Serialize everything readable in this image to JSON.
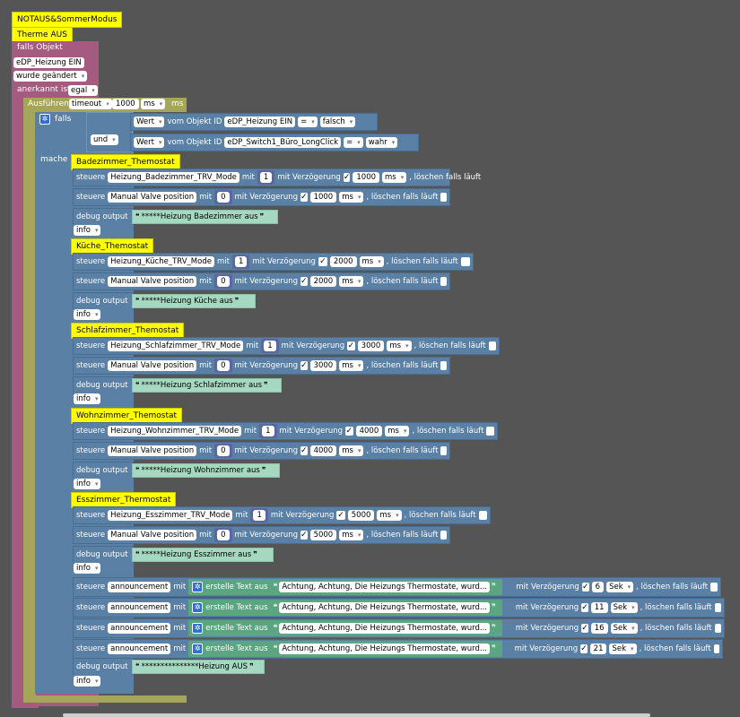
{
  "header": {
    "comment1": "NOTAUS&SommerModus",
    "comment2": "Therme AUS"
  },
  "trigger": {
    "falls_objekt": "falls Objekt",
    "object_id": "eDP_Heizung EIN",
    "wurde": "wurde geändert",
    "anerkannt": "anerkannt ist",
    "anerkannt_val": "egal"
  },
  "timeout": {
    "ausfuehren": "Ausführen",
    "timeout_dd": "timeout",
    "in": "in",
    "val": "1000",
    "unit": "ms",
    "unit2": "ms"
  },
  "if_block": {
    "falls": "falls",
    "und": "und",
    "mache": "mache",
    "cond1": {
      "wert": "Wert",
      "vom": "vom Objekt ID",
      "id": "eDP_Heizung EIN",
      "op": "=",
      "val": "falsch"
    },
    "cond2": {
      "wert": "Wert",
      "vom": "vom Objekt ID",
      "id": "eDP_Switch1_Büro_LongClick",
      "op": "=",
      "val": "wahr"
    }
  },
  "labels": {
    "steuere": "steuere",
    "mit": "mit",
    "mit_verz": "mit Verzögerung",
    "loeschen": ", löschen falls läuft",
    "debug": "debug output",
    "info": "info",
    "erstelle": "erstelle Text aus",
    "check": "✓"
  },
  "rooms": [
    {
      "comment": "Badezimmer_Themostat",
      "mode": "Heizung_Badezimmer_TRV_Mode",
      "mode_val": "1",
      "mode_delay": "1000",
      "mode_unit": "ms",
      "valve": "Manual Valve position",
      "valve_val": "0",
      "valve_delay": "1000",
      "valve_unit": "ms",
      "debug": "*****Heizung Badezimmer aus"
    },
    {
      "comment": "Küche_Themostat",
      "mode": "Heizung_Küche_TRV_Mode",
      "mode_val": "1",
      "mode_delay": "2000",
      "mode_unit": "ms",
      "valve": "Manual Valve position",
      "valve_val": "0",
      "valve_delay": "2000",
      "valve_unit": "ms",
      "debug": "*****Heizung Küche aus"
    },
    {
      "comment": "Schlafzimmer_Themostat",
      "mode": "Heizung_Schlafzimmer_TRV_Mode",
      "mode_val": "1",
      "mode_delay": "3000",
      "mode_unit": "ms",
      "valve": "Manual Valve position",
      "valve_val": "0",
      "valve_delay": "3000",
      "valve_unit": "ms",
      "debug": "*****Heizung Schlafzimmer aus"
    },
    {
      "comment": "Wohnzimmer_Themostat",
      "mode": "Heizung_Wohnzimmer_TRV_Mode",
      "mode_val": "1",
      "mode_delay": "4000",
      "mode_unit": "ms",
      "valve": "Manual Valve position",
      "valve_val": "0",
      "valve_delay": "4000",
      "valve_unit": "ms",
      "debug": "*****Heizung Wohnzimmer aus"
    },
    {
      "comment": "Esszimmer_Thermostat",
      "mode": "Heizung_Esszimmer_TRV_Mode",
      "mode_val": "1",
      "mode_delay": "5000",
      "mode_unit": "ms",
      "valve": "Manual Valve position",
      "valve_val": "0",
      "valve_delay": "5000",
      "valve_unit": "ms",
      "debug": "*****Heizung Esszimmer aus"
    }
  ],
  "announcements": [
    {
      "target": "announcement",
      "text": "Achtung, Achtung, Die Heizungs Thermostate, wurd...",
      "delay": "6",
      "unit": "Sek"
    },
    {
      "target": "announcement",
      "text": "Achtung, Achtung, Die Heizungs Thermostate, wurd...",
      "delay": "11",
      "unit": "Sek"
    },
    {
      "target": "announcement",
      "text": "Achtung, Achtung, Die Heizungs Thermostate, wurd...",
      "delay": "16",
      "unit": "Sek"
    },
    {
      "target": "announcement",
      "text": "Achtung, Achtung, Die Heizungs Thermostate, wurd...",
      "delay": "21",
      "unit": "Sek"
    }
  ],
  "final_debug": "***************Heizung AUS"
}
